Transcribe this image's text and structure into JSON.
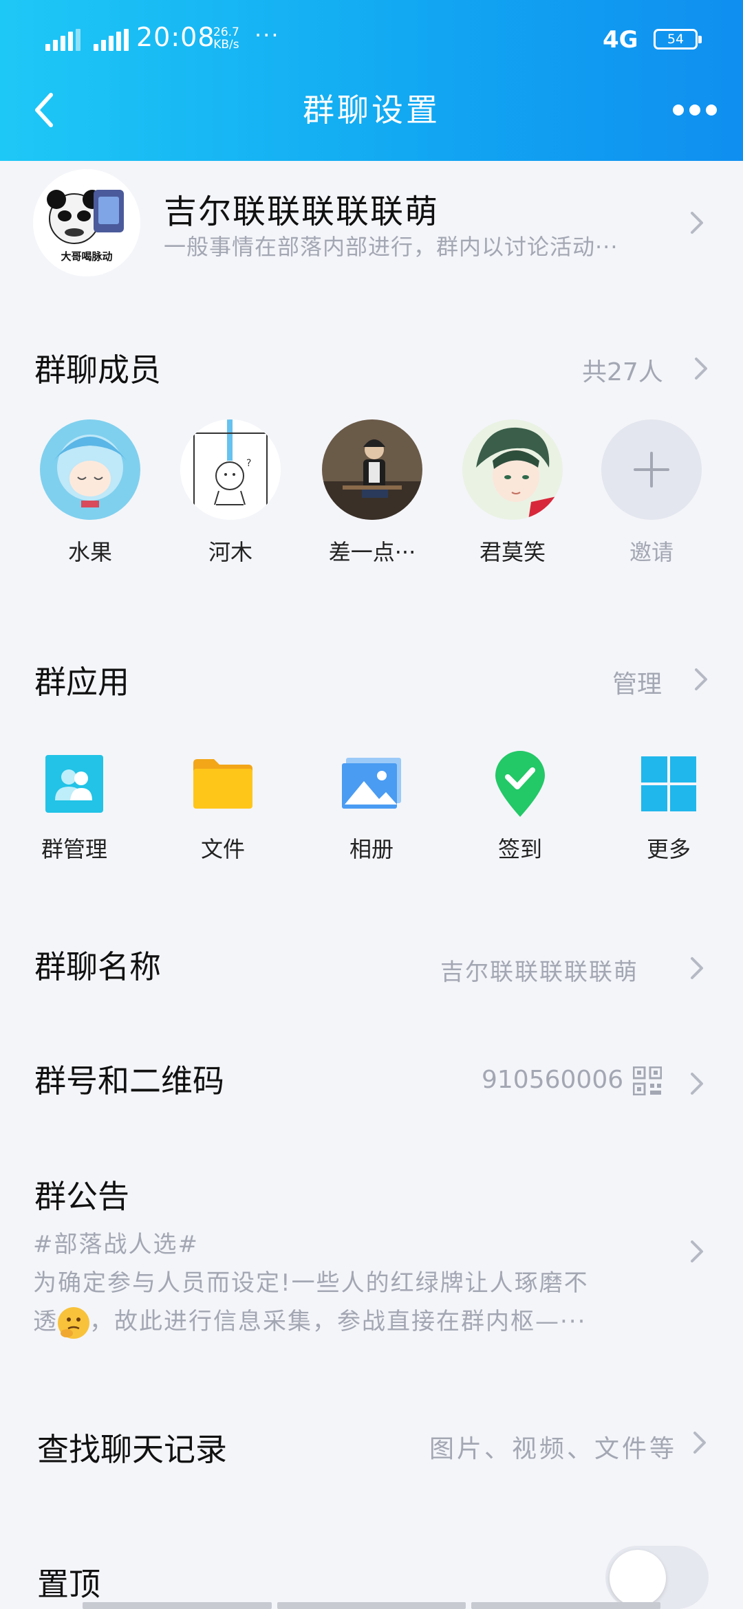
{
  "status_bar": {
    "time": "20:08",
    "net_speed_value": "26.7",
    "net_speed_unit": "KB/s",
    "overflow": "···",
    "network": "4G",
    "battery": "54"
  },
  "header": {
    "title": "群聊设置"
  },
  "group": {
    "avatar_caption": "大哥喝脉动",
    "name": "吉尔联联联联联萌",
    "description": "一般事情在部落内部进行，群内以讨论活动···"
  },
  "members": {
    "title": "群聊成员",
    "count": "共27人",
    "list": [
      {
        "name": "水果"
      },
      {
        "name": "河木"
      },
      {
        "name": "差一点···"
      },
      {
        "name": "君莫笑"
      }
    ],
    "invite_label": "邀请"
  },
  "apps": {
    "title": "群应用",
    "manage": "管理",
    "items": [
      {
        "label": "群管理",
        "icon": "group-manage-icon",
        "color": "#22c3e6"
      },
      {
        "label": "文件",
        "icon": "folder-icon",
        "color": "#ffc61a"
      },
      {
        "label": "相册",
        "icon": "photo-album-icon",
        "color": "#4a9cf2"
      },
      {
        "label": "签到",
        "icon": "checkin-icon",
        "color": "#23c867"
      },
      {
        "label": "更多",
        "icon": "grid-icon",
        "color": "#20b7ec"
      }
    ]
  },
  "rows": {
    "group_name_label": "群聊名称",
    "group_name_value": "吉尔联联联联联萌",
    "group_id_label": "群号和二维码",
    "group_id_value": "910560006",
    "notice_label": "群公告",
    "notice_line1": "#部落战人选#",
    "notice_line2": "为确定参与人员而设定!一些人的红绿牌让人琢磨不",
    "notice_line3a": "透",
    "notice_line3b": "，故此进行信息采集，参战直接在群内枢—···",
    "search_label": "查找聊天记录",
    "search_value": "图片、视频、文件等",
    "pin_label": "置顶"
  },
  "colors": {
    "header_start": "#1ec8f6",
    "header_end": "#0f8ff0",
    "background": "#f4f5f9",
    "secondary_text": "#a3a7b3"
  }
}
